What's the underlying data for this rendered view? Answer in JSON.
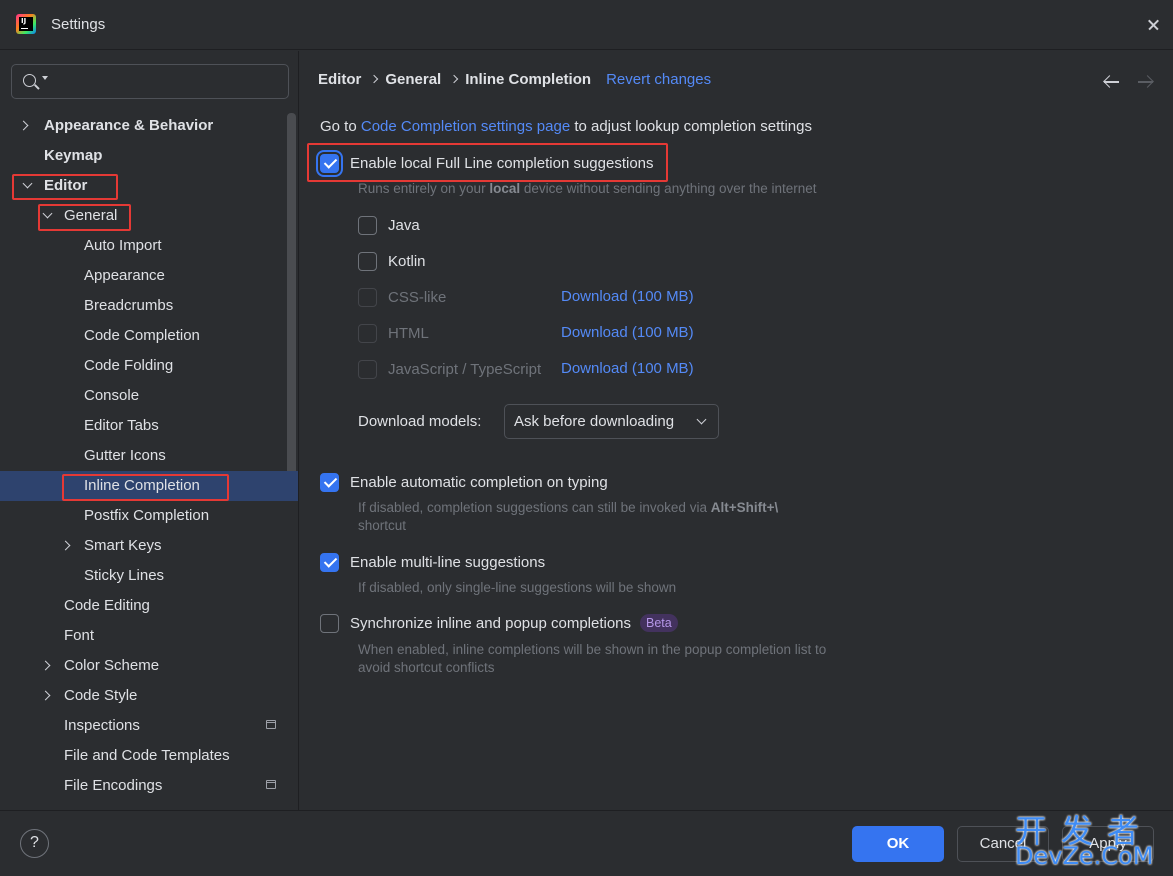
{
  "window": {
    "title": "Settings",
    "app_icon_text": "IJ"
  },
  "sidebar": {
    "search": {
      "value": "",
      "placeholder": ""
    },
    "items": [
      {
        "label": "Appearance & Behavior",
        "expandable": true,
        "expanded": false
      },
      {
        "label": "Keymap"
      },
      {
        "label": "Editor",
        "expandable": true,
        "expanded": true
      },
      {
        "label": "General",
        "expandable": true,
        "expanded": true
      },
      {
        "label": "Auto Import"
      },
      {
        "label": "Appearance"
      },
      {
        "label": "Breadcrumbs"
      },
      {
        "label": "Code Completion"
      },
      {
        "label": "Code Folding"
      },
      {
        "label": "Console"
      },
      {
        "label": "Editor Tabs"
      },
      {
        "label": "Gutter Icons"
      },
      {
        "label": "Inline Completion",
        "selected": true
      },
      {
        "label": "Postfix Completion"
      },
      {
        "label": "Smart Keys",
        "expandable": true,
        "expanded": false
      },
      {
        "label": "Sticky Lines"
      },
      {
        "label": "Code Editing"
      },
      {
        "label": "Font"
      },
      {
        "label": "Color Scheme",
        "expandable": true,
        "expanded": false
      },
      {
        "label": "Code Style",
        "expandable": true,
        "expanded": false
      },
      {
        "label": "Inspections",
        "icon": "project-settings-icon"
      },
      {
        "label": "File and Code Templates"
      },
      {
        "label": "File Encodings",
        "icon": "project-settings-icon"
      }
    ]
  },
  "breadcrumb": {
    "items": [
      "Editor",
      "General",
      "Inline Completion"
    ],
    "revert_label": "Revert changes"
  },
  "content": {
    "intro": {
      "prefix": "Go to ",
      "link": "Code Completion settings page",
      "suffix": " to adjust lookup completion settings"
    },
    "full_line": {
      "label": "Enable local Full Line completion suggestions",
      "checked": true,
      "hint_prefix": "Runs entirely on your ",
      "hint_bold": "local",
      "hint_suffix": " device without sending anything over the internet"
    },
    "languages": [
      {
        "label": "Java",
        "checked": false,
        "enabled": true
      },
      {
        "label": "Kotlin",
        "checked": false,
        "enabled": true
      },
      {
        "label": "CSS-like",
        "checked": false,
        "enabled": false,
        "download": "Download (100 MB)"
      },
      {
        "label": "HTML",
        "checked": false,
        "enabled": false,
        "download": "Download (100 MB)"
      },
      {
        "label": "JavaScript / TypeScript",
        "checked": false,
        "enabled": false,
        "download": "Download (100 MB)"
      }
    ],
    "download_models": {
      "label": "Download models:",
      "value": "Ask before downloading"
    },
    "auto_completion": {
      "label": "Enable automatic completion on typing",
      "checked": true,
      "hint_prefix": "If disabled, completion suggestions can still be invoked via ",
      "hint_bold": "Alt+Shift+\\",
      "hint_line2": "shortcut"
    },
    "multi_line": {
      "label": "Enable multi-line suggestions",
      "checked": true,
      "hint": "If disabled, only single-line suggestions will be shown"
    },
    "sync_popup": {
      "label": "Synchronize inline and popup completions",
      "checked": false,
      "badge": "Beta",
      "hint_line1": "When enabled, inline completions will be shown in the popup completion list to",
      "hint_line2": "avoid shortcut conflicts"
    }
  },
  "footer": {
    "help_label": "?",
    "ok_label": "OK",
    "cancel_label": "Cancel",
    "apply_label": "Apply"
  },
  "watermark": {
    "top": "开发者",
    "bottom": "DevZe.CoM"
  },
  "colors": {
    "background": "#2b2d30",
    "accent": "#3574f0",
    "link": "#548af7",
    "selection": "#2e436e",
    "highlight_box": "#e53935",
    "badge_bg": "#43325e",
    "badge_fg": "#b596e8"
  }
}
